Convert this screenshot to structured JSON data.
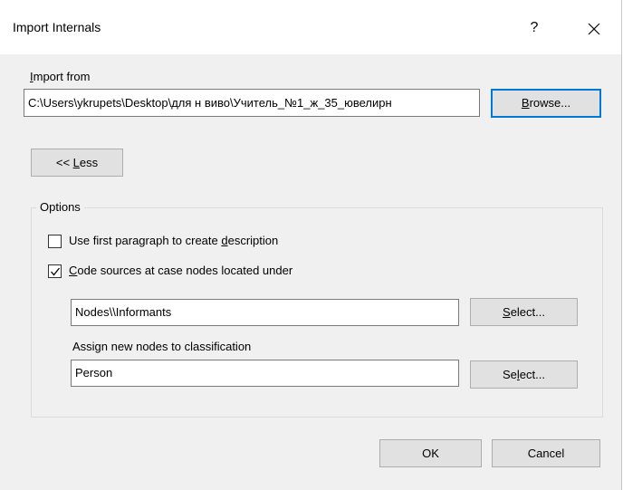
{
  "window": {
    "title": "Import Internals",
    "help_label": "?"
  },
  "import_from": {
    "label_ul": "I",
    "label_rest": "mport from",
    "path": "C:\\Users\\ykrupets\\Desktop\\для н виво\\Учитель_№1_ж_35_ювелирн",
    "browse_ul": "B",
    "browse_rest": "rowse..."
  },
  "less_button": {
    "pre": "<< ",
    "ul": "L",
    "rest": "ess"
  },
  "options": {
    "legend": "Options",
    "first_paragraph": {
      "pre": "Use first paragraph to create ",
      "ul": "d",
      "rest": "escription",
      "checked": false
    },
    "code_sources": {
      "ul": "C",
      "rest": "ode sources at case nodes located under",
      "checked": true
    },
    "nodes_path": "Nodes\\\\Informants",
    "select1_ul": "S",
    "select1_rest": "elect...",
    "classification_label": "Assign new nodes to classification",
    "classification_value": "Person",
    "select2_pre": "Se",
    "select2_ul": "l",
    "select2_rest": "ect..."
  },
  "footer": {
    "ok_label": "OK",
    "cancel_label": "Cancel"
  },
  "colors": {
    "dialog_bg": "#f0f0f0",
    "default_button_border": "#0078d7"
  }
}
